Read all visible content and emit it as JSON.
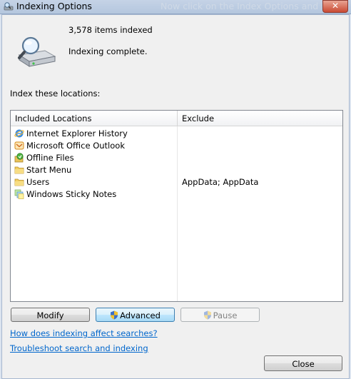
{
  "window": {
    "title": "Indexing Options",
    "background_text": "Now click on the Index Options and",
    "close_symbol": "✕"
  },
  "summary": {
    "items_indexed": "3,578 items indexed",
    "status": "Indexing complete."
  },
  "locations": {
    "label": "Index these locations:",
    "columns": [
      "Included Locations",
      "Exclude"
    ],
    "rows": [
      {
        "name": "Internet Explorer History",
        "exclude": "",
        "icon": "internet-explorer-icon"
      },
      {
        "name": "Microsoft Office Outlook",
        "exclude": "",
        "icon": "outlook-icon"
      },
      {
        "name": "Offline Files",
        "exclude": "",
        "icon": "offline-files-icon"
      },
      {
        "name": "Start Menu",
        "exclude": "",
        "icon": "folder-icon"
      },
      {
        "name": "Users",
        "exclude": "AppData; AppData",
        "icon": "folder-icon"
      },
      {
        "name": "Windows Sticky Notes",
        "exclude": "",
        "icon": "sticky-notes-icon"
      }
    ]
  },
  "buttons": {
    "modify": "Modify",
    "advanced": "Advanced",
    "pause": "Pause",
    "close": "Close"
  },
  "links": {
    "how_affects": "How does indexing affect searches?",
    "troubleshoot": "Troubleshoot search and indexing"
  },
  "colors": {
    "link": "#0066cc",
    "window_frame": "#dbe4ef",
    "dialog_bg": "#f0f0f0"
  }
}
